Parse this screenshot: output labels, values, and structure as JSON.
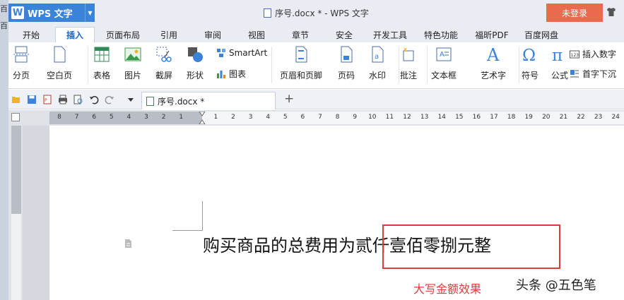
{
  "behind": {
    "text1": "百",
    "text2": "百"
  },
  "titlebar": {
    "app_name": "WPS 文字",
    "document_title": "序号.docx * - WPS 文字",
    "login_label": "未登录"
  },
  "tabs": [
    "开始",
    "插入",
    "页面布局",
    "引用",
    "审阅",
    "视图",
    "章节",
    "安全",
    "开发工具",
    "特色功能",
    "福昕PDF",
    "百度网盘"
  ],
  "active_tab": "插入",
  "ribbon": {
    "page_break": "分页",
    "blank_page": "空白页",
    "table": "表格",
    "picture": "图片",
    "screenshot": "截屏",
    "shapes": "形状",
    "smartart": "SmartArt",
    "chart": "图表",
    "header_footer": "页眉和页脚",
    "page_number": "页码",
    "watermark": "水印",
    "comment": "批注",
    "textbox": "文本框",
    "wordart": "艺术字",
    "symbol": "符号",
    "formula": "公式",
    "insert_number": "插入数字",
    "drop_cap": "首字下沉"
  },
  "quickaccess": {
    "doc_tab": "序号.docx *"
  },
  "ruler": {
    "ticks": [
      "8",
      "7",
      "6",
      "5",
      "4",
      "3",
      "2",
      "1",
      "",
      "1",
      "2",
      "3",
      "4",
      "5",
      "6",
      "7",
      "8",
      "9",
      "10",
      "11",
      "12",
      "13",
      "14",
      "15",
      "16",
      "17",
      "18",
      "19",
      "20",
      "21",
      "22",
      "23",
      "24"
    ]
  },
  "document": {
    "body_text": "购买商品的总费用为贰仟壹佰零捌元整",
    "annotation_caption": "大写金额效果",
    "watermark": "头条 @五色笔"
  },
  "colors": {
    "accent": "#3a83d9",
    "login": "#ea6a4e",
    "annotation": "#e23b3b"
  }
}
